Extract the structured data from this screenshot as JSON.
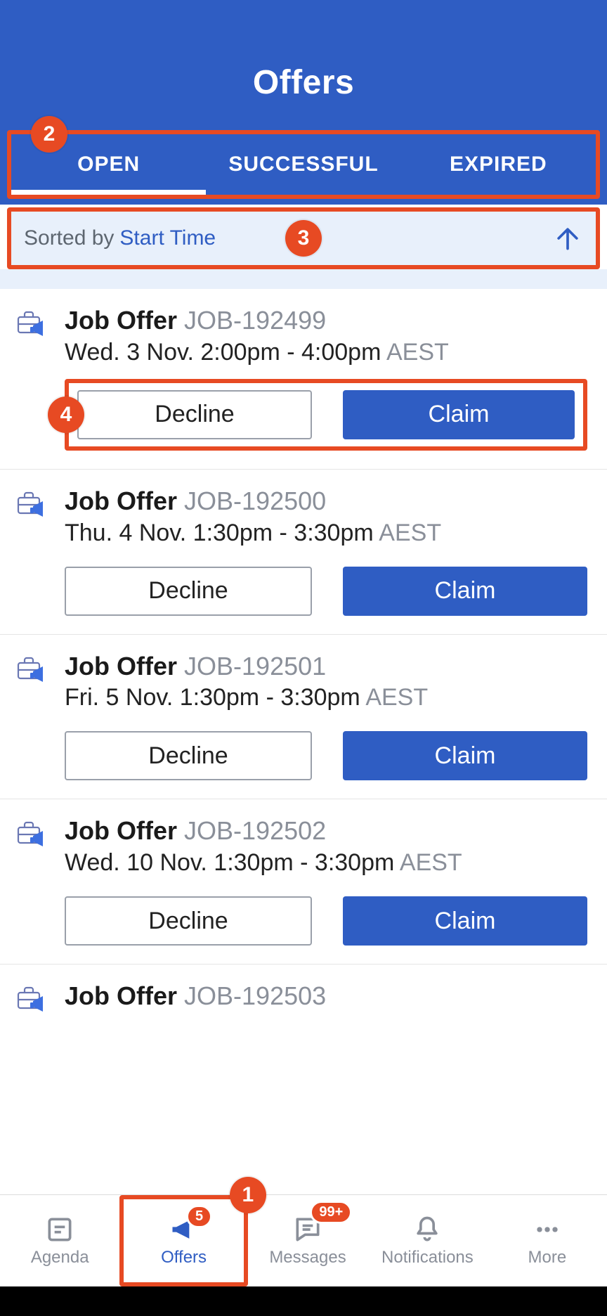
{
  "header": {
    "title": "Offers"
  },
  "tabs": {
    "open": "OPEN",
    "successful": "SUCCESSFUL",
    "expired": "EXPIRED"
  },
  "sort": {
    "prefix": "Sorted by",
    "field": "Start Time"
  },
  "buttons": {
    "decline": "Decline",
    "claim": "Claim"
  },
  "common": {
    "title": "Job Offer"
  },
  "offers": [
    {
      "id": "JOB-192499",
      "time": "Wed. 3 Nov. 2:00pm - 4:00pm",
      "tz": "AEST"
    },
    {
      "id": "JOB-192500",
      "time": "Thu. 4 Nov. 1:30pm - 3:30pm",
      "tz": "AEST"
    },
    {
      "id": "JOB-192501",
      "time": "Fri. 5 Nov. 1:30pm - 3:30pm",
      "tz": "AEST"
    },
    {
      "id": "JOB-192502",
      "time": "Wed. 10 Nov. 1:30pm - 3:30pm",
      "tz": "AEST"
    },
    {
      "id": "JOB-192503",
      "time": "",
      "tz": ""
    }
  ],
  "nav": {
    "agenda": "Agenda",
    "offers": "Offers",
    "messages": "Messages",
    "notifications": "Notifications",
    "more": "More",
    "offers_badge": "5",
    "messages_badge": "99+"
  },
  "callouts": {
    "c1": "1",
    "c2": "2",
    "c3": "3",
    "c4": "4"
  }
}
